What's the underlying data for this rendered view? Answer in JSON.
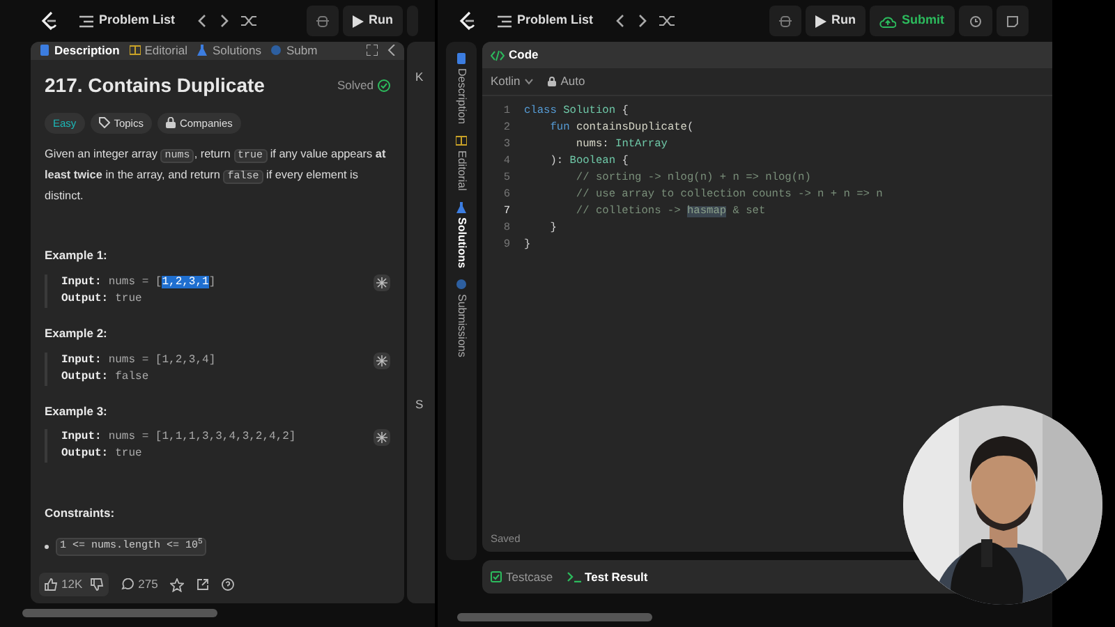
{
  "left": {
    "toolbar": {
      "title": "Problem List",
      "run": "Run"
    },
    "tabs": [
      {
        "label": "Description",
        "selected": true
      },
      {
        "label": "Editorial",
        "selected": false
      },
      {
        "label": "Solutions",
        "selected": false
      },
      {
        "label": "Subm",
        "selected": false
      }
    ],
    "problem": {
      "title": "217. Contains Duplicate",
      "status": "Solved",
      "tags": [
        {
          "label": "Easy",
          "kind": "difficulty"
        },
        {
          "label": "Topics",
          "kind": "topics"
        },
        {
          "label": "Companies",
          "kind": "companies"
        }
      ],
      "description": [
        {
          "text": "Given an integer array ",
          "kind": "plain"
        },
        {
          "text": "nums",
          "kind": "code"
        },
        {
          "text": ", return ",
          "kind": "plain"
        },
        {
          "text": "true",
          "kind": "code"
        },
        {
          "text": " if any value appears ",
          "kind": "plain"
        },
        {
          "text": "at least twice",
          "kind": "bold"
        },
        {
          "text": " in the array, and return ",
          "kind": "plain"
        },
        {
          "text": "false",
          "kind": "code"
        },
        {
          "text": " if every element is distinct.",
          "kind": "plain"
        }
      ],
      "examples": [
        {
          "heading": "Example 1:",
          "input_label": "Input:",
          "input": [
            {
              "text": "nums = [",
              "selected": false
            },
            {
              "text": "1,2,3,1",
              "selected": true
            },
            {
              "text": "]",
              "selected": false
            }
          ],
          "output_label": "Output:",
          "output": "true"
        },
        {
          "heading": "Example 2:",
          "input_label": "Input:",
          "input": [
            {
              "text": "nums = [1,2,3,4]",
              "selected": false
            }
          ],
          "output_label": "Output:",
          "output": "false"
        },
        {
          "heading": "Example 3:",
          "input_label": "Input:",
          "input": [
            {
              "text": "nums = [1,1,1,3,3,4,3,2,4,2]",
              "selected": false
            }
          ],
          "output_label": "Output:",
          "output": "true"
        }
      ],
      "constraints_heading": "Constraints:",
      "constraints": [
        "1 <= nums.length <= 10$^{5}$"
      ]
    },
    "footer": {
      "likes": "12K",
      "comments": "275"
    }
  },
  "side_fragment": [
    "K",
    "S"
  ],
  "right": {
    "toolbar": {
      "title": "Problem List",
      "run": "Run",
      "submit": "Submit"
    },
    "side_tabs": [
      {
        "label": "Description",
        "selected": false
      },
      {
        "label": "Editorial",
        "selected": false
      },
      {
        "label": "Solutions",
        "selected": true
      },
      {
        "label": "Submissions",
        "selected": false
      }
    ],
    "editor": {
      "title": "Code",
      "language": "Kotlin",
      "mode": "Auto",
      "status": "Saved",
      "lines": [
        {
          "number": "1",
          "current": false,
          "tokens": [
            {
              "text": "class ",
              "kind": "kw"
            },
            {
              "text": "Solution",
              "kind": "type"
            },
            {
              "text": " {",
              "kind": "punct"
            }
          ]
        },
        {
          "number": "2",
          "current": false,
          "tokens": [
            {
              "text": "    fun ",
              "kind": "kw"
            },
            {
              "text": "containsDuplicate",
              "kind": "name"
            },
            {
              "text": "(",
              "kind": "punct"
            }
          ]
        },
        {
          "number": "3",
          "current": false,
          "tokens": [
            {
              "text": "        nums",
              "kind": "name"
            },
            {
              "text": ": ",
              "kind": "punct"
            },
            {
              "text": "IntArray",
              "kind": "type"
            }
          ]
        },
        {
          "number": "4",
          "current": false,
          "tokens": [
            {
              "text": "    ): ",
              "kind": "punct"
            },
            {
              "text": "Boolean",
              "kind": "type"
            },
            {
              "text": " {",
              "kind": "punct"
            }
          ]
        },
        {
          "number": "5",
          "current": false,
          "tokens": [
            {
              "text": "        // sorting -> nlog(n) + n => nlog(n)",
              "kind": "comment"
            }
          ]
        },
        {
          "number": "6",
          "current": false,
          "tokens": [
            {
              "text": "        // use array to collection counts -> n + n => n",
              "kind": "comment"
            }
          ]
        },
        {
          "number": "7",
          "current": true,
          "tokens": [
            {
              "text": "        // colletions -> ",
              "kind": "comment"
            },
            {
              "text": "hasmap",
              "kind": "match"
            },
            {
              "text": " & set",
              "kind": "comment"
            }
          ]
        },
        {
          "number": "8",
          "current": false,
          "tokens": [
            {
              "text": "    }",
              "kind": "punct"
            }
          ]
        },
        {
          "number": "9",
          "current": false,
          "tokens": [
            {
              "text": "}",
              "kind": "punct"
            }
          ]
        }
      ]
    },
    "bottom_tabs": [
      {
        "label": "Testcase",
        "selected": false
      },
      {
        "label": "Test Result",
        "selected": true
      }
    ]
  },
  "webcam": {
    "kind": "picture"
  }
}
